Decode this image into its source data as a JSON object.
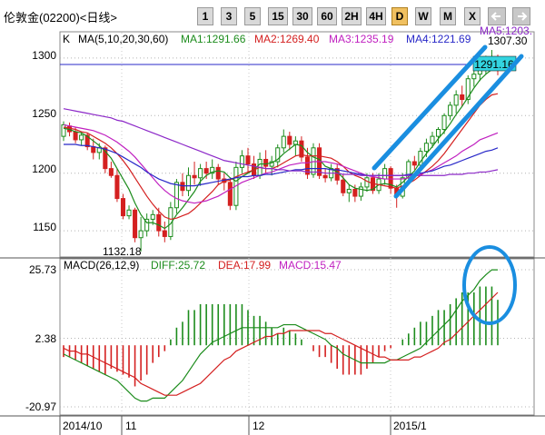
{
  "header": {
    "title": "伦敦金(02200)<日线>",
    "buttons": [
      {
        "label": "1",
        "active": false
      },
      {
        "label": "3",
        "active": false
      },
      {
        "label": "5",
        "active": false
      },
      {
        "label": "15",
        "active": false
      },
      {
        "label": "30",
        "active": false
      },
      {
        "label": "60",
        "active": false
      },
      {
        "label": "2H",
        "active": false
      },
      {
        "label": "4H",
        "active": false
      },
      {
        "label": "D",
        "active": true
      },
      {
        "label": "W",
        "active": false
      },
      {
        "label": "M",
        "active": false
      },
      {
        "label": "X",
        "active": false
      }
    ],
    "prev_icon": "arrow-left-icon",
    "next_icon": "arrow-right-icon"
  },
  "price_panel": {
    "k_label": "K",
    "ma_label": "MA(5,10,20,30,60)",
    "ma_values": [
      {
        "text": "MA1:1291.66",
        "color": "#1c8c1c"
      },
      {
        "text": "MA2:1269.40",
        "color": "#d42020"
      },
      {
        "text": "MA3:1235.19",
        "color": "#c020c0"
      },
      {
        "text": "MA4:1221.69",
        "color": "#2828c8"
      },
      {
        "text": "MA5:1203.",
        "color": "#8c28c8"
      }
    ],
    "y_ticks": [
      "1300",
      "1250",
      "1200",
      "1150"
    ],
    "last_price": "1291.16",
    "high_label": "1307.30",
    "low_label": "1132.18"
  },
  "macd_panel": {
    "label": "MACD(26,12,9)",
    "diff": {
      "text": "DIFF:25.72",
      "color": "#1c8c1c"
    },
    "dea": {
      "text": "DEA:17.99",
      "color": "#d42020"
    },
    "macd": {
      "text": "MACD:15.47",
      "color": "#c020c0"
    },
    "y_ticks": [
      "25.73",
      "2.38",
      "-20.97"
    ]
  },
  "x_axis": {
    "labels": [
      "2014/10",
      "11",
      "12",
      "2015/1"
    ]
  },
  "colors": {
    "up": "#1c8c1c",
    "down": "#d42020",
    "annotation": "#1a8ee0",
    "current": "#2828c8",
    "last_price_bg": "#33d4e0"
  },
  "chart_data": {
    "type": "candlestick",
    "count": 74,
    "candles": [
      {
        "o": 1232,
        "h": 1245,
        "l": 1228,
        "c": 1242
      },
      {
        "o": 1241,
        "h": 1244,
        "l": 1232,
        "c": 1236
      },
      {
        "o": 1236,
        "h": 1240,
        "l": 1226,
        "c": 1229
      },
      {
        "o": 1229,
        "h": 1236,
        "l": 1224,
        "c": 1233
      },
      {
        "o": 1233,
        "h": 1235,
        "l": 1220,
        "c": 1223
      },
      {
        "o": 1223,
        "h": 1230,
        "l": 1212,
        "c": 1218
      },
      {
        "o": 1218,
        "h": 1226,
        "l": 1212,
        "c": 1222
      },
      {
        "o": 1222,
        "h": 1224,
        "l": 1200,
        "c": 1204
      },
      {
        "o": 1204,
        "h": 1210,
        "l": 1196,
        "c": 1198
      },
      {
        "o": 1198,
        "h": 1204,
        "l": 1175,
        "c": 1178
      },
      {
        "o": 1178,
        "h": 1182,
        "l": 1160,
        "c": 1163
      },
      {
        "o": 1163,
        "h": 1172,
        "l": 1160,
        "c": 1168
      },
      {
        "o": 1168,
        "h": 1170,
        "l": 1140,
        "c": 1144
      },
      {
        "o": 1144,
        "h": 1162,
        "l": 1132,
        "c": 1150
      },
      {
        "o": 1150,
        "h": 1165,
        "l": 1145,
        "c": 1160
      },
      {
        "o": 1160,
        "h": 1168,
        "l": 1155,
        "c": 1164
      },
      {
        "o": 1164,
        "h": 1170,
        "l": 1145,
        "c": 1150
      },
      {
        "o": 1150,
        "h": 1158,
        "l": 1140,
        "c": 1145
      },
      {
        "o": 1145,
        "h": 1175,
        "l": 1142,
        "c": 1170
      },
      {
        "o": 1170,
        "h": 1195,
        "l": 1165,
        "c": 1192
      },
      {
        "o": 1192,
        "h": 1200,
        "l": 1180,
        "c": 1185
      },
      {
        "o": 1185,
        "h": 1205,
        "l": 1180,
        "c": 1198
      },
      {
        "o": 1198,
        "h": 1210,
        "l": 1190,
        "c": 1196
      },
      {
        "o": 1196,
        "h": 1208,
        "l": 1189,
        "c": 1204
      },
      {
        "o": 1204,
        "h": 1210,
        "l": 1195,
        "c": 1200
      },
      {
        "o": 1200,
        "h": 1212,
        "l": 1195,
        "c": 1205
      },
      {
        "o": 1205,
        "h": 1208,
        "l": 1190,
        "c": 1195
      },
      {
        "o": 1195,
        "h": 1200,
        "l": 1185,
        "c": 1192
      },
      {
        "o": 1192,
        "h": 1195,
        "l": 1168,
        "c": 1172
      },
      {
        "o": 1172,
        "h": 1210,
        "l": 1168,
        "c": 1205
      },
      {
        "o": 1205,
        "h": 1220,
        "l": 1200,
        "c": 1215
      },
      {
        "o": 1215,
        "h": 1222,
        "l": 1200,
        "c": 1208
      },
      {
        "o": 1208,
        "h": 1215,
        "l": 1195,
        "c": 1198
      },
      {
        "o": 1198,
        "h": 1218,
        "l": 1195,
        "c": 1212
      },
      {
        "o": 1212,
        "h": 1220,
        "l": 1200,
        "c": 1206
      },
      {
        "o": 1206,
        "h": 1215,
        "l": 1198,
        "c": 1210
      },
      {
        "o": 1210,
        "h": 1225,
        "l": 1205,
        "c": 1222
      },
      {
        "o": 1222,
        "h": 1238,
        "l": 1218,
        "c": 1232
      },
      {
        "o": 1232,
        "h": 1236,
        "l": 1220,
        "c": 1225
      },
      {
        "o": 1225,
        "h": 1232,
        "l": 1215,
        "c": 1228
      },
      {
        "o": 1228,
        "h": 1232,
        "l": 1210,
        "c": 1214
      },
      {
        "o": 1214,
        "h": 1222,
        "l": 1195,
        "c": 1199
      },
      {
        "o": 1199,
        "h": 1226,
        "l": 1196,
        "c": 1222
      },
      {
        "o": 1222,
        "h": 1226,
        "l": 1195,
        "c": 1198
      },
      {
        "o": 1198,
        "h": 1204,
        "l": 1192,
        "c": 1196
      },
      {
        "o": 1196,
        "h": 1208,
        "l": 1193,
        "c": 1204
      },
      {
        "o": 1204,
        "h": 1208,
        "l": 1190,
        "c": 1194
      },
      {
        "o": 1194,
        "h": 1199,
        "l": 1180,
        "c": 1183
      },
      {
        "o": 1183,
        "h": 1190,
        "l": 1175,
        "c": 1186
      },
      {
        "o": 1186,
        "h": 1190,
        "l": 1175,
        "c": 1180
      },
      {
        "o": 1180,
        "h": 1192,
        "l": 1176,
        "c": 1188
      },
      {
        "o": 1188,
        "h": 1200,
        "l": 1184,
        "c": 1196
      },
      {
        "o": 1196,
        "h": 1200,
        "l": 1182,
        "c": 1185
      },
      {
        "o": 1185,
        "h": 1200,
        "l": 1182,
        "c": 1195
      },
      {
        "o": 1195,
        "h": 1208,
        "l": 1190,
        "c": 1204
      },
      {
        "o": 1204,
        "h": 1206,
        "l": 1182,
        "c": 1187
      },
      {
        "o": 1187,
        "h": 1190,
        "l": 1170,
        "c": 1180
      },
      {
        "o": 1180,
        "h": 1200,
        "l": 1178,
        "c": 1196
      },
      {
        "o": 1196,
        "h": 1212,
        "l": 1194,
        "c": 1210
      },
      {
        "o": 1210,
        "h": 1215,
        "l": 1203,
        "c": 1207
      },
      {
        "o": 1207,
        "h": 1222,
        "l": 1204,
        "c": 1219
      },
      {
        "o": 1219,
        "h": 1230,
        "l": 1214,
        "c": 1226
      },
      {
        "o": 1226,
        "h": 1236,
        "l": 1222,
        "c": 1232
      },
      {
        "o": 1232,
        "h": 1240,
        "l": 1226,
        "c": 1238
      },
      {
        "o": 1238,
        "h": 1252,
        "l": 1234,
        "c": 1250
      },
      {
        "o": 1250,
        "h": 1262,
        "l": 1246,
        "c": 1259
      },
      {
        "o": 1259,
        "h": 1272,
        "l": 1252,
        "c": 1268
      },
      {
        "o": 1268,
        "h": 1276,
        "l": 1258,
        "c": 1264
      },
      {
        "o": 1264,
        "h": 1285,
        "l": 1260,
        "c": 1282
      },
      {
        "o": 1282,
        "h": 1290,
        "l": 1275,
        "c": 1286
      },
      {
        "o": 1286,
        "h": 1298,
        "l": 1280,
        "c": 1294
      },
      {
        "o": 1294,
        "h": 1302,
        "l": 1286,
        "c": 1296
      },
      {
        "o": 1296,
        "h": 1307,
        "l": 1289,
        "c": 1300
      },
      {
        "o": 1300,
        "h": 1303,
        "l": 1285,
        "c": 1291
      }
    ],
    "ma_series": [
      {
        "color": "#1c8c1c",
        "y": [
          1239,
          1238,
          1236,
          1235,
          1232,
          1228,
          1224,
          1219,
          1213,
          1204,
          1195,
          1186,
          1174,
          1164,
          1157,
          1157,
          1155,
          1152,
          1156,
          1164,
          1170,
          1177,
          1184,
          1193,
          1198,
          1201,
          1202,
          1201,
          1196,
          1193,
          1197,
          1200,
          1203,
          1208,
          1208,
          1209,
          1212,
          1217,
          1221,
          1225,
          1224,
          1218,
          1214,
          1212,
          1206,
          1204,
          1201,
          1196,
          1190,
          1187,
          1186,
          1185,
          1186,
          1190,
          1191,
          1190,
          1188,
          1192,
          1197,
          1202,
          1210,
          1217,
          1223,
          1230,
          1236,
          1243,
          1251,
          1258,
          1266,
          1274,
          1281,
          1286,
          1290,
          1292
        ]
      },
      {
        "color": "#d42020",
        "y": [
          1240,
          1239,
          1238,
          1236,
          1235,
          1232,
          1229,
          1226,
          1222,
          1217,
          1211,
          1204,
          1196,
          1188,
          1180,
          1173,
          1167,
          1162,
          1160,
          1161,
          1163,
          1165,
          1169,
          1174,
          1179,
          1184,
          1190,
          1193,
          1194,
          1197,
          1199,
          1201,
          1203,
          1205,
          1204,
          1204,
          1206,
          1209,
          1212,
          1215,
          1216,
          1215,
          1215,
          1215,
          1214,
          1213,
          1210,
          1206,
          1201,
          1198,
          1196,
          1193,
          1191,
          1190,
          1189,
          1188,
          1187,
          1189,
          1191,
          1194,
          1198,
          1202,
          1206,
          1211,
          1217,
          1224,
          1231,
          1238,
          1245,
          1252,
          1259,
          1264,
          1268,
          1269
        ]
      },
      {
        "color": "#c020c0",
        "y": [
          1242,
          1241,
          1240,
          1239,
          1238,
          1237,
          1235,
          1233,
          1230,
          1227,
          1223,
          1219,
          1214,
          1208,
          1202,
          1196,
          1190,
          1185,
          1181,
          1178,
          1176,
          1175,
          1174,
          1175,
          1176,
          1178,
          1180,
          1183,
          1186,
          1189,
          1192,
          1194,
          1196,
          1198,
          1200,
          1201,
          1203,
          1205,
          1207,
          1208,
          1209,
          1209,
          1210,
          1210,
          1210,
          1209,
          1208,
          1206,
          1204,
          1202,
          1200,
          1198,
          1197,
          1196,
          1195,
          1195,
          1195,
          1195,
          1196,
          1197,
          1199,
          1201,
          1203,
          1206,
          1209,
          1212,
          1215,
          1219,
          1222,
          1225,
          1229,
          1231,
          1233,
          1235
        ]
      },
      {
        "color": "#2828c8",
        "y": [
          1225,
          1225,
          1225,
          1224,
          1224,
          1223,
          1222,
          1221,
          1219,
          1217,
          1214,
          1211,
          1208,
          1205,
          1201,
          1198,
          1195,
          1193,
          1191,
          1190,
          1189,
          1189,
          1189,
          1190,
          1191,
          1192,
          1193,
          1194,
          1195,
          1196,
          1197,
          1197,
          1198,
          1198,
          1199,
          1199,
          1200,
          1201,
          1202,
          1203,
          1203,
          1204,
          1204,
          1204,
          1204,
          1203,
          1203,
          1202,
          1201,
          1200,
          1199,
          1198,
          1198,
          1198,
          1198,
          1198,
          1198,
          1198,
          1199,
          1199,
          1200,
          1201,
          1202,
          1204,
          1206,
          1207,
          1209,
          1211,
          1213,
          1215,
          1217,
          1219,
          1220,
          1222
        ]
      },
      {
        "color": "#8c28c8",
        "y": [
          1256,
          1255,
          1254,
          1253,
          1252,
          1251,
          1250,
          1249,
          1248,
          1246,
          1245,
          1243,
          1241,
          1239,
          1237,
          1235,
          1233,
          1231,
          1229,
          1227,
          1225,
          1223,
          1221,
          1219,
          1217,
          1215,
          1213,
          1211,
          1210,
          1209,
          1208,
          1207,
          1206,
          1205,
          1204,
          1204,
          1203,
          1203,
          1202,
          1202,
          1202,
          1201,
          1201,
          1201,
          1200,
          1200,
          1200,
          1199,
          1199,
          1199,
          1198,
          1198,
          1198,
          1198,
          1198,
          1198,
          1198,
          1198,
          1198,
          1198,
          1198,
          1198,
          1198,
          1198,
          1198,
          1199,
          1199,
          1199,
          1200,
          1200,
          1201,
          1201,
          1202,
          1203
        ]
      }
    ],
    "macd_diff": [
      -3,
      -4,
      -5,
      -6,
      -7,
      -8,
      -9,
      -10,
      -11,
      -12,
      -14,
      -16,
      -18,
      -19,
      -19,
      -18,
      -18,
      -18,
      -16,
      -14,
      -12,
      -9,
      -6,
      -3,
      -1,
      1,
      2,
      3,
      4,
      5,
      6,
      6,
      6,
      6,
      6,
      6,
      6,
      7,
      7,
      7,
      6,
      5,
      4,
      3,
      2,
      0,
      -1,
      -3,
      -4,
      -5,
      -6,
      -6,
      -6,
      -6,
      -6,
      -5,
      -5,
      -4,
      -3,
      -2,
      -1,
      1,
      3,
      5,
      7,
      9,
      12,
      15,
      17,
      19,
      22,
      24,
      25.7,
      25.7
    ],
    "macd_dea": [
      -1,
      -2,
      -2,
      -3,
      -3,
      -4,
      -5,
      -6,
      -7,
      -8,
      -9,
      -10,
      -11,
      -13,
      -14,
      -15,
      -16,
      -17,
      -17,
      -17,
      -16,
      -15,
      -14,
      -13,
      -11,
      -9,
      -7,
      -5,
      -4,
      -2,
      -1,
      0,
      1,
      2,
      3,
      3,
      4,
      4,
      5,
      5,
      5,
      5,
      5,
      5,
      4,
      4,
      3,
      2,
      1,
      0,
      -1,
      -2,
      -3,
      -4,
      -4,
      -5,
      -5,
      -5,
      -5,
      -4,
      -4,
      -3,
      -2,
      -1,
      1,
      2,
      4,
      6,
      8,
      10,
      12,
      14,
      16,
      18
    ],
    "macd_hist": [
      -4,
      -4,
      -5,
      -6,
      -7,
      -8,
      -9,
      -10,
      -8,
      -9,
      -10,
      -11,
      -14,
      -12,
      -10,
      -6,
      -4,
      -2,
      2,
      6,
      8,
      12,
      12,
      14,
      14,
      14,
      14,
      14,
      14,
      14,
      14,
      12,
      10,
      10,
      8,
      6,
      4,
      6,
      5,
      4,
      2,
      0,
      -2,
      -4,
      -4,
      -6,
      -8,
      -10,
      -10,
      -10,
      -10,
      -8,
      -6,
      -4,
      -2,
      -1,
      0,
      2,
      4,
      6,
      8,
      8,
      10,
      12,
      12,
      14,
      16,
      18,
      18,
      18,
      20,
      20,
      20,
      15.47
    ],
    "price_ylim": [
      1128,
      1322
    ],
    "macd_ylim": [
      -20.97,
      25.73
    ]
  }
}
